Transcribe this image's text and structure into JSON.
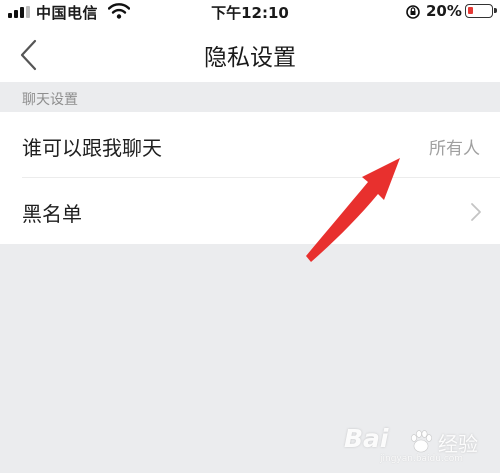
{
  "status_bar": {
    "carrier": "中国电信",
    "time": "下午12:10",
    "battery_percent": "20%",
    "battery_level": 0.2,
    "battery_color": "#e53935"
  },
  "nav": {
    "back_icon": "chevron-left-icon",
    "title": "隐私设置"
  },
  "section": {
    "header": "聊天设置"
  },
  "items": [
    {
      "label": "谁可以跟我聊天",
      "value": "所有人"
    },
    {
      "label": "黑名单",
      "icon": "chevron-right-icon"
    }
  ],
  "annotation": {
    "type": "arrow",
    "color": "#e8302e"
  },
  "watermark": {
    "brand": "Bai",
    "suffix": "经验",
    "url": "jingyan.baidu.com"
  }
}
